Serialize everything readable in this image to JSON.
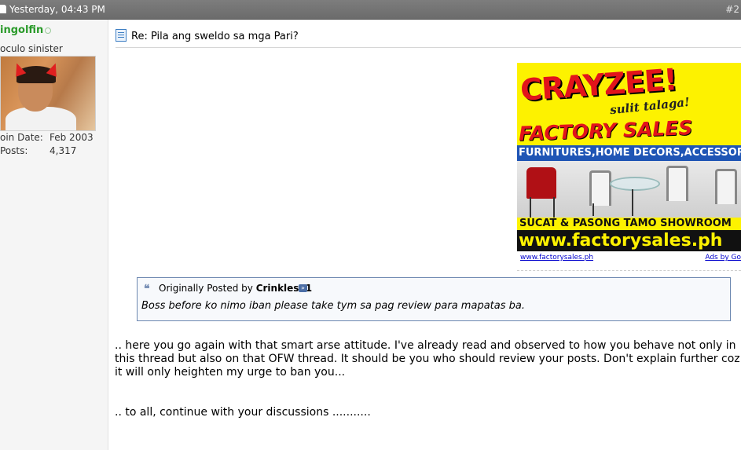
{
  "post": {
    "date": "Yesterday, 04:43 PM",
    "number": "#2",
    "title": "Re: Pila ang sweldo sa mga Pari?"
  },
  "user": {
    "name": "ingolfin",
    "title": "oculo sinister",
    "join_label": "oin Date:",
    "join_value": "Feb 2003",
    "posts_label": "Posts:",
    "posts_value": "4,317"
  },
  "ad": {
    "headline": "CRAYZEE!",
    "tagline": "sulit talaga!",
    "brand": "FACTORY SALES",
    "categories": "FURNITURES,HOME DECORS,ACCESSORIE",
    "showroom": "SUCAT & PASONG TAMO SHOWROOM",
    "url": "www.factorysales.ph",
    "footer_link": "www.factorysales.ph",
    "footer_ads": "Ads by Go"
  },
  "quote": {
    "prefix": "Originally Posted by",
    "author": "Crinkles11",
    "text": "Boss before ko nimo iban please take tym sa pag review para mapatas ba."
  },
  "message": {
    "paragraph1": ".. here you go again with that smart arse attitude. I've already read and observed to how you behave not only in this thread but also on that OFW thread. It should be you who should review your posts. Don't explain further coz it will only heighten my urge to ban you...",
    "paragraph2": ".. to all, continue with your discussions ..........."
  },
  "colors": {
    "header_bg": "#737373",
    "username": "#2a9a2a",
    "quote_border": "#6c87b0",
    "ad_yellow": "#fdf200",
    "ad_red": "#e2141b",
    "ad_blue": "#1f55b5"
  },
  "icons": {
    "post": "document-icon",
    "quote": "quote-icon",
    "view_post": "view-post-arrow-icon",
    "status": "offline-status-icon"
  }
}
